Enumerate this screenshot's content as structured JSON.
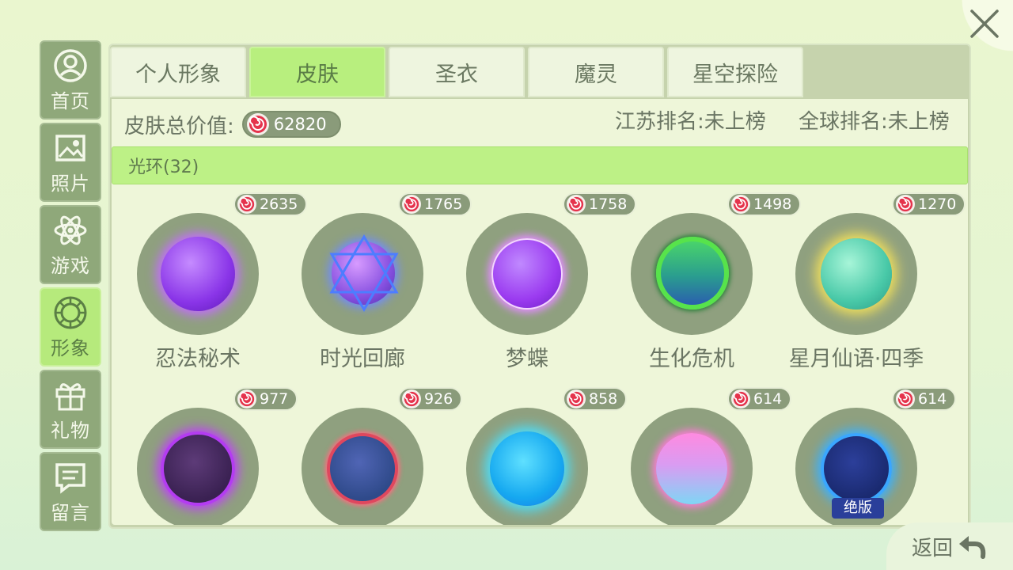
{
  "sidebar": {
    "items": [
      {
        "label": "首页",
        "icon": "user-circle-icon"
      },
      {
        "label": "照片",
        "icon": "image-icon"
      },
      {
        "label": "游戏",
        "icon": "atom-icon"
      },
      {
        "label": "形象",
        "icon": "gem-icon",
        "active": true
      },
      {
        "label": "礼物",
        "icon": "gift-icon"
      },
      {
        "label": "留言",
        "icon": "message-icon"
      }
    ]
  },
  "tabs": [
    {
      "label": "个人形象"
    },
    {
      "label": "皮肤",
      "active": true
    },
    {
      "label": "圣衣"
    },
    {
      "label": "魔灵"
    },
    {
      "label": "星空探险"
    }
  ],
  "stats": {
    "total_label": "皮肤总价值:",
    "total_value": "62820",
    "province_rank": "江苏排名:未上榜",
    "global_rank": "全球排名:未上榜"
  },
  "category": {
    "label": "光环(32)"
  },
  "items": [
    {
      "name": "忍法秘术",
      "price": "2635",
      "color": "#9a4cf0"
    },
    {
      "name": "时光回廊",
      "price": "1765",
      "color": "#6b5ae8"
    },
    {
      "name": "梦蝶",
      "price": "1758",
      "color": "#a24ef2"
    },
    {
      "name": "生化危机",
      "price": "1498",
      "color": "#2fb07a"
    },
    {
      "name": "星月仙语·四季",
      "price": "1270",
      "color": "#58d6b8"
    },
    {
      "name": "",
      "price": "977",
      "color": "#5a2a7a"
    },
    {
      "name": "",
      "price": "926",
      "color": "#2f4a8a"
    },
    {
      "name": "",
      "price": "858",
      "color": "#17b8f0"
    },
    {
      "name": "",
      "price": "614",
      "color": "#d38df0"
    },
    {
      "name": "",
      "price": "614",
      "color": "#1f3a8a",
      "badge": "绝版"
    }
  ],
  "back": {
    "label": "返回",
    "icon": "back-arrow-icon"
  }
}
